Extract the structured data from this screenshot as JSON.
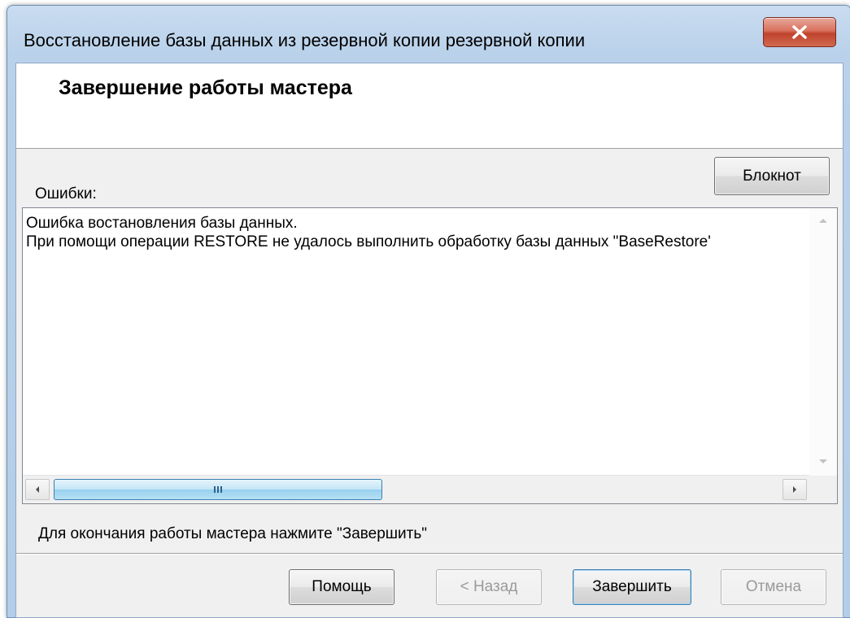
{
  "window": {
    "title": "Восстановление базы данных из резервной копии резервной копии",
    "close_glyph": "X"
  },
  "header": {
    "title": "Завершение работы мастера"
  },
  "errors": {
    "label": "Ошибки:",
    "notepad_button": "Блокнот",
    "lines": [
      "Ошибка востановления базы данных.",
      "При помощи операции RESTORE не удалось выполнить обработку базы данных \"BaseRestore'"
    ]
  },
  "hint": "Для окончания работы мастера нажмите \"Завершить\"",
  "buttons": {
    "help": "Помощь",
    "back": "< Назад",
    "finish": "Завершить",
    "cancel": "Отмена"
  },
  "colors": {
    "close_button": "#c0432c",
    "scroll_thumb": "#98d1ef",
    "dialog_background": "#f0f0f0"
  },
  "icons": {
    "close": "close-icon",
    "scroll_up": "scroll-up-arrow-icon",
    "scroll_down": "scroll-down-arrow-icon",
    "scroll_left": "scroll-left-arrow-icon",
    "scroll_right": "scroll-right-arrow-icon",
    "grip": "scroll-grip-icon"
  }
}
